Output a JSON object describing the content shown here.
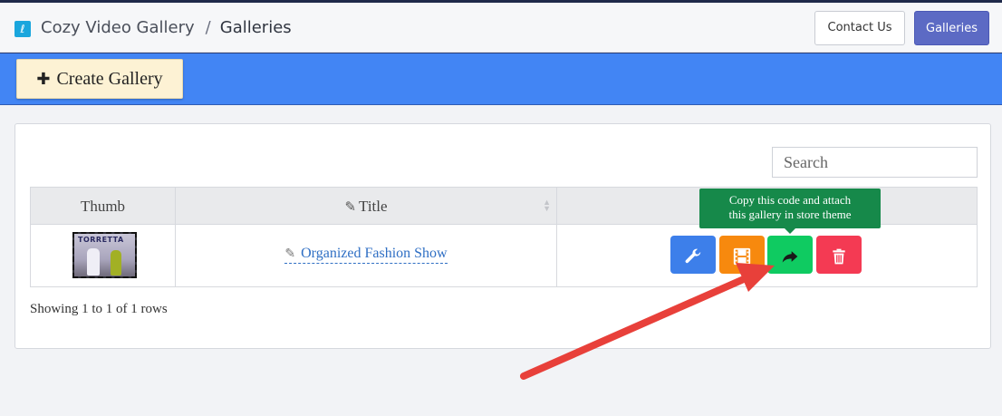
{
  "header": {
    "logo_letter": "ℓ",
    "app_name": "Cozy Video Gallery",
    "separator": "/",
    "current_page": "Galleries",
    "contact_label": "Contact Us",
    "galleries_label": "Galleries"
  },
  "toolbar": {
    "create_icon": "plus-icon",
    "create_label": "Create Gallery"
  },
  "search": {
    "placeholder": "Search",
    "value": ""
  },
  "table": {
    "columns": [
      {
        "label": "Thumb"
      },
      {
        "label": "Title",
        "icon": "pencil-icon",
        "sortable": true
      },
      {
        "label": ""
      }
    ],
    "rows": [
      {
        "thumb_text": "TORRETTA",
        "title": "Organized Fashion Show",
        "actions": [
          "wrench-icon",
          "film-icon",
          "share-icon",
          "trash-icon"
        ]
      }
    ]
  },
  "tooltip": {
    "line1": "Copy this code and attach",
    "line2": "this gallery in store theme"
  },
  "footer": {
    "pagination_text": "Showing 1 to 1 of 1 rows"
  },
  "colors": {
    "blue_bar": "#4285f4",
    "primary": "#5c6ac4",
    "edit": "#3d7fea",
    "video": "#f7890e",
    "share": "#0fcb61",
    "delete": "#f43a53",
    "tooltip": "#16894a",
    "annotation_arrow": "#e8403a"
  }
}
